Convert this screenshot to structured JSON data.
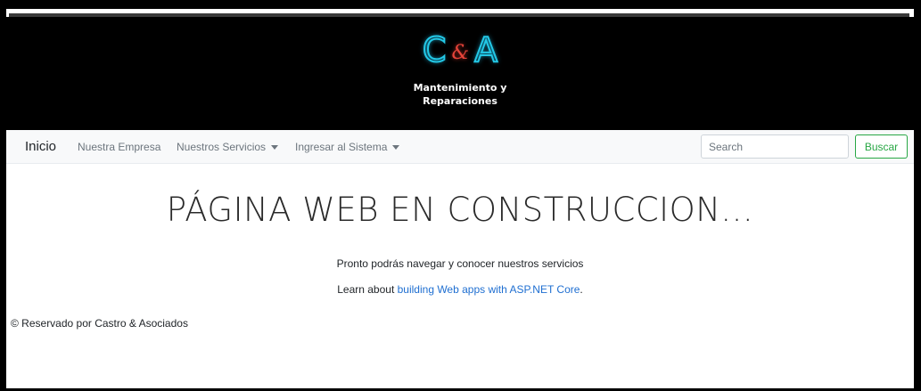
{
  "header": {
    "logo_c": "C",
    "logo_amp": "&",
    "logo_a": "A",
    "tagline_line1": "Mantenimiento y",
    "tagline_line2": "Reparaciones"
  },
  "navbar": {
    "brand": "Inicio",
    "items": [
      {
        "label": "Nuestra Empresa",
        "dropdown": false
      },
      {
        "label": "Nuestros Servicios",
        "dropdown": true
      },
      {
        "label": "Ingresar al Sistema",
        "dropdown": true
      }
    ],
    "search_placeholder": "Search",
    "search_button": "Buscar"
  },
  "main": {
    "heading": "PÁGINA WEB EN CONSTRUCCION...",
    "lead": "Pronto podrás navegar y conocer nuestros servicios",
    "learn_prefix": "Learn about ",
    "learn_link": "building Web apps with ASP.NET Core",
    "learn_suffix": "."
  },
  "footer": {
    "text": "© Reservado por Castro & Asociados"
  },
  "colors": {
    "logo_cyan": "#23c8e6",
    "logo_red": "#e6443a",
    "success_green": "#28a745",
    "link_blue": "#1f6fd1",
    "navbar_bg": "#f8f9fa"
  }
}
